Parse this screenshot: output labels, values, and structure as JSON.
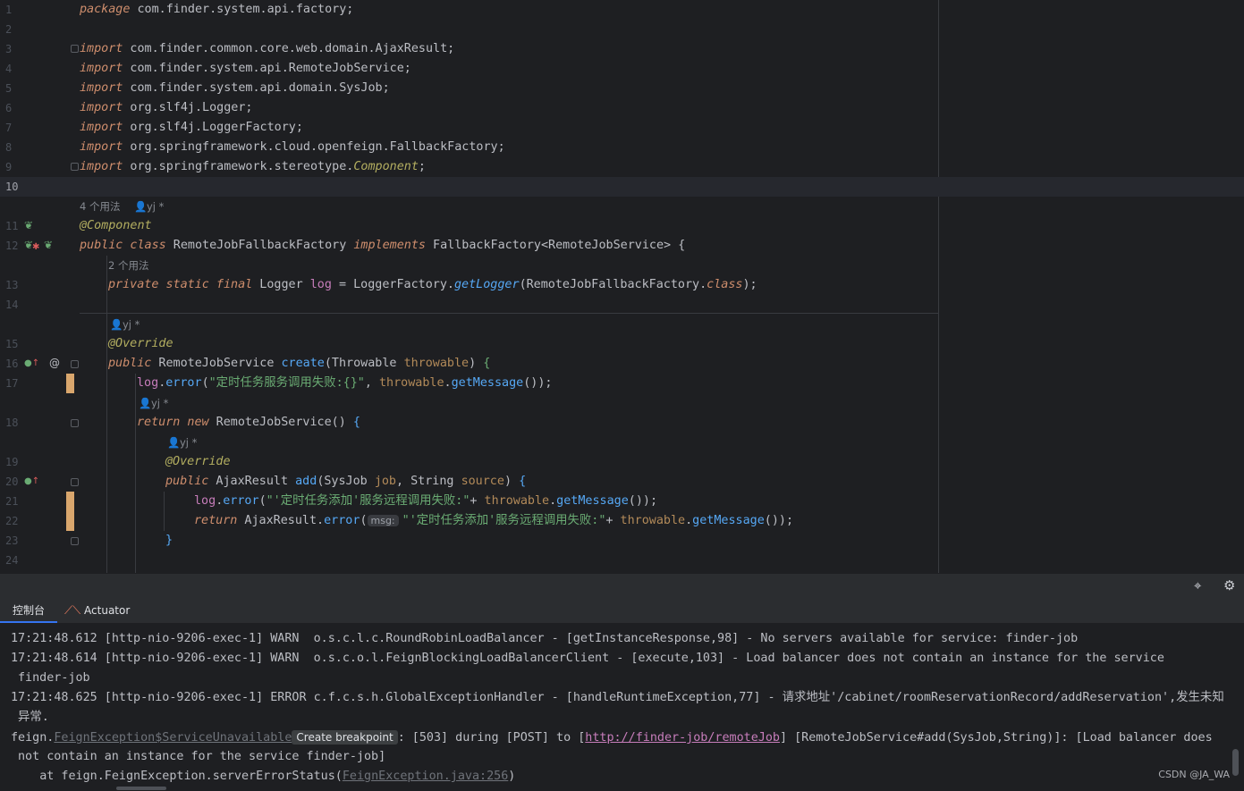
{
  "editor": {
    "line_numbers": [
      "1",
      "2",
      "3",
      "4",
      "5",
      "6",
      "7",
      "8",
      "9",
      "10",
      "11",
      "12",
      "13",
      "14",
      "15",
      "16",
      "17",
      "18",
      "19",
      "20",
      "21",
      "22",
      "23",
      "24"
    ],
    "lines": {
      "l1_kw": "package",
      "l1_rest": " com.finder.system.api.factory;",
      "import_kw": "import",
      "l3": " com.finder.common.core.web.domain.AjaxResult;",
      "l4": " com.finder.system.api.RemoteJobService;",
      "l5": " com.finder.system.api.domain.SysJob;",
      "l6": " org.slf4j.Logger;",
      "l7": " org.slf4j.LoggerFactory;",
      "l8": " org.springframework.cloud.openfeign.FallbackFactory;",
      "l9_a": " org.springframework.stereotype.",
      "l9_b": "Component",
      "l9_c": ";",
      "l11": "@Component",
      "l12_a": "public class",
      "l12_b": " RemoteJobFallbackFactory ",
      "l12_c": "implements",
      "l12_d": " FallbackFactory<RemoteJobService> ",
      "l12_e": "{",
      "l13_a": "private static final",
      "l13_b": " Logger ",
      "l13_c": "log",
      "l13_d": " = LoggerFactory.",
      "l13_e": "getLogger",
      "l13_f": "(RemoteJobFallbackFactory.",
      "l13_g": "class",
      "l13_h": ");",
      "l15": "@Override",
      "l16_a": "public",
      "l16_b": " RemoteJobService ",
      "l16_c": "create",
      "l16_d": "(Throwable ",
      "l16_e": "throwable",
      "l16_f": ") ",
      "l16_g": "{",
      "l17_a": "log",
      "l17_b": ".",
      "l17_c": "error",
      "l17_d": "(",
      "l17_e": "\"定时任务服务调用失败:{}\"",
      "l17_f": ", ",
      "l17_g": "throwable",
      "l17_h": ".",
      "l17_i": "getMessage",
      "l17_j": "());",
      "l18_a": "return new",
      "l18_b": " RemoteJobService() ",
      "l18_c": "{",
      "l19": "@Override",
      "l20_a": "public",
      "l20_b": " AjaxResult ",
      "l20_c": "add",
      "l20_d": "(SysJob ",
      "l20_e": "job",
      "l20_f": ", String ",
      "l20_g": "source",
      "l20_h": ") ",
      "l20_i": "{",
      "l21_a": "log",
      "l21_b": ".",
      "l21_c": "error",
      "l21_d": "(",
      "l21_e": "\"'定时任务添加'服务远程调用失败:\"",
      "l21_f": "+ ",
      "l21_g": "throwable",
      "l21_h": ".",
      "l21_i": "getMessage",
      "l21_j": "());",
      "l22_a": "return",
      "l22_b": " AjaxResult.",
      "l22_c": "error",
      "l22_d": "(",
      "l22_param": "msg:",
      "l22_e": "\"'定时任务添加'服务远程调用失败:\"",
      "l22_f": "+ ",
      "l22_g": "throwable",
      "l22_h": ".",
      "l22_i": "getMessage",
      "l22_j": "());",
      "l23": "}"
    },
    "hints": {
      "usages_4": "4 个用法",
      "usages_2": "2 个用法",
      "author": "yj *"
    },
    "gutter_icons": {
      "bean": "bean-icon",
      "at": "@",
      "override": "override-icon"
    }
  },
  "toolstrip": {
    "crosshair_icon": "⌖",
    "settings_icon": "⚙"
  },
  "tabs": [
    {
      "label": "控制台",
      "active": true
    },
    {
      "label": "Actuator",
      "active": false
    }
  ],
  "console": {
    "line1": "17:21:48.612 [http-nio-9206-exec-1] WARN  o.s.c.l.c.RoundRobinLoadBalancer - [getInstanceResponse,98] - No servers available for service: finder-job",
    "line2": "17:21:48.614 [http-nio-9206-exec-1] WARN  o.s.c.o.l.FeignBlockingLoadBalancerClient - [execute,103] - Load balancer does not contain an instance for the service",
    "line2_wrap": "finder-job",
    "line3": "17:21:48.625 [http-nio-9206-exec-1] ERROR c.f.c.s.h.GlobalExceptionHandler - [handleRuntimeException,77] - 请求地址'/cabinet/roomReservationRecord/addReservation',发生未知",
    "line3_wrap": "异常.",
    "line4_a": "feign.",
    "line4_b": "FeignException$ServiceUnavailable",
    "line4_bp": "Create breakpoint",
    "line4_c": ": [503] during [POST] to [",
    "line4_link": "http://finder-job/remoteJob",
    "line4_d": "] [RemoteJobService#add(SysJob,String)]: [Load balancer does",
    "line4_wrap": "not contain an instance for the service finder-job]",
    "line5_a": "    at feign.FeignException.serverErrorStatus(",
    "line5_link": "FeignException.java:256",
    "line5_b": ")"
  },
  "watermark": "CSDN @JA_WA",
  "colors": {
    "background": "#1e1f22",
    "keyword": "#cf8e6d",
    "string": "#6aab73",
    "function": "#56a8f5",
    "annotation": "#b3ae60",
    "field": "#c77dbb",
    "param": "#b28a59",
    "modified": "#d9a66d"
  }
}
